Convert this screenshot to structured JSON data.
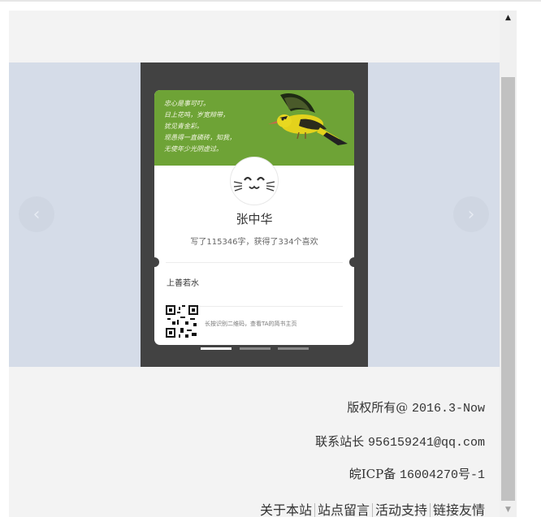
{
  "carousel": {
    "prev_icon": "chevron-left-icon",
    "next_icon": "chevron-right-icon",
    "prev_glyph": "‹",
    "next_glyph": "›",
    "slide_count": 3,
    "active_slide": 1
  },
  "card": {
    "poem_lines": [
      "忠心是事可叮。",
      "日上花鸣，岁宽辩带，",
      "犹见青金彩。",
      "现愚得一直磷砖，知我，",
      "无使年少光阴虚过。"
    ],
    "author_name": "张中华",
    "stats": "写了115346字，获得了334个喜欢",
    "motto": "上善若水",
    "qr_hint": "长按识别二维码，查看TA的简书主页",
    "colors": {
      "banner": "#6ea336",
      "card_bg": "#424242",
      "carousel_bg": "#d5dce8"
    }
  },
  "footer": {
    "copyright_label": "版权所有@",
    "copyright_value": "2016.3-Now",
    "contact_label": "联系站长",
    "contact_value": "956159241@qq.com",
    "icp_label": "皖ICP备",
    "icp_value": "16004270号-1",
    "links": [
      "关于本站",
      "站点留言",
      "活动支持",
      "链接友情"
    ]
  },
  "scrollbar": {
    "up_glyph": "▲",
    "down_glyph": "▼"
  }
}
